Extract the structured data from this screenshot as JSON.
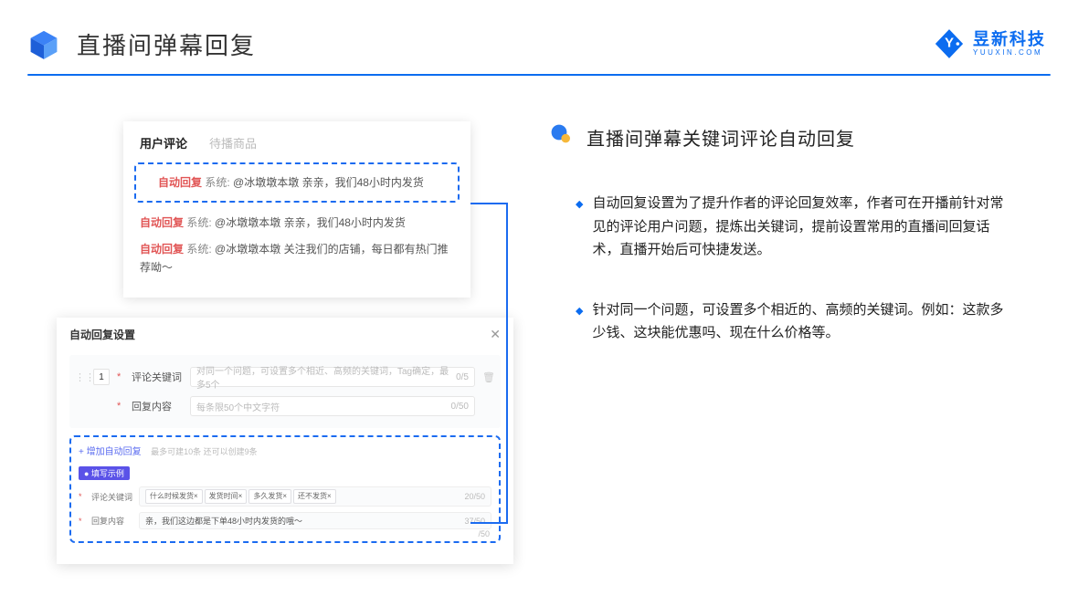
{
  "header": {
    "title": "直播间弹幕回复"
  },
  "brand": {
    "cn": "昱新科技",
    "en": "YUUXIN.COM"
  },
  "panel1": {
    "tab_active": "用户评论",
    "tab_inactive": "待播商品",
    "comments": [
      {
        "badge": "自动回复",
        "sys": "系统:",
        "text": "@冰墩墩本墩 亲亲，我们48小时内发货"
      },
      {
        "badge": "自动回复",
        "sys": "系统:",
        "text": "@冰墩墩本墩 亲亲，我们48小时内发货"
      },
      {
        "badge": "自动回复",
        "sys": "系统:",
        "text": "@冰墩墩本墩 关注我们的店铺，每日都有热门推荐呦～"
      }
    ]
  },
  "panel2": {
    "title": "自动回复设置",
    "close": "✕",
    "row1": {
      "num": "1",
      "label": "评论关键词",
      "placeholder": "对同一个问题，可设置多个相近、高频的关键词，Tag确定，最多5个",
      "count": "0/5"
    },
    "row2": {
      "label": "回复内容",
      "placeholder": "每条限50个中文字符",
      "count": "0/50"
    },
    "add_link": "+ 增加自动回复",
    "add_hint": "最多可建10条 还可以创建9条",
    "example_badge": "● 填写示例",
    "ex1": {
      "label": "评论关键词",
      "tags": [
        "什么时候发货×",
        "发货时间×",
        "多久发货×",
        "还不发货×"
      ],
      "count": "20/50"
    },
    "ex2": {
      "label": "回复内容",
      "text": "亲，我们这边都是下单48小时内发货的哦～",
      "count": "37/50"
    },
    "faux_count": "/50"
  },
  "right": {
    "title": "直播间弹幕关键词评论自动回复",
    "b1": "自动回复设置为了提升作者的评论回复效率，作者可在开播前针对常见的评论用户问题，提炼出关键词，提前设置常用的直播间回复话术，直播开始后可快捷发送。",
    "b2": "针对同一个问题，可设置多个相近的、高频的关键词。例如：这款多少钱、这块能优惠吗、现在什么价格等。"
  }
}
